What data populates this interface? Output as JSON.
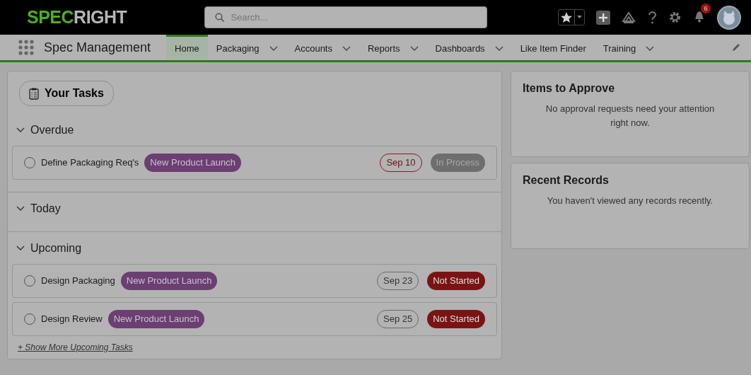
{
  "header": {
    "logo_accent": "SPEC",
    "logo_rest": "RIGHT",
    "search": {
      "placeholder": "Search..."
    },
    "notifications_count": "6"
  },
  "nav": {
    "app_name": "Spec Management",
    "tabs": [
      {
        "label": "Home",
        "selected": true,
        "has_menu": false
      },
      {
        "label": "Packaging",
        "selected": false,
        "has_menu": true
      },
      {
        "label": "Accounts",
        "selected": false,
        "has_menu": true
      },
      {
        "label": "Reports",
        "selected": false,
        "has_menu": true
      },
      {
        "label": "Dashboards",
        "selected": false,
        "has_menu": true
      },
      {
        "label": "Like Item Finder",
        "selected": false,
        "has_menu": false
      },
      {
        "label": "Training",
        "selected": false,
        "has_menu": true
      }
    ]
  },
  "tasks": {
    "title": "Your Tasks",
    "groups": [
      {
        "label": "Overdue",
        "expanded": true,
        "items": [
          {
            "name": "Define Packaging Req's",
            "checked": false,
            "tag": "New Product Launch",
            "date": "Sep 10",
            "overdue": true,
            "status": "In Process",
            "kind": "in-process"
          }
        ]
      },
      {
        "label": "Today",
        "expanded": true
      },
      {
        "label": "Upcoming",
        "expanded": true,
        "items": [
          {
            "name": "Design Packaging",
            "checked": false,
            "tag": "New Product Launch",
            "date": "Sep 23",
            "overdue": false,
            "status": "Not Started",
            "kind": "not-started"
          },
          {
            "name": "Design Review",
            "checked": false,
            "tag": "New Product Launch",
            "date": "Sep 25",
            "overdue": false,
            "status": "Not Started",
            "kind": "not-started"
          }
        ],
        "more_link": "+ Show More Upcoming Tasks"
      }
    ]
  },
  "side_cards": [
    {
      "title": "Items to Approve",
      "message": "No approval requests need your attention right now."
    },
    {
      "title": "Recent Records",
      "message": "You haven't viewed any records recently."
    }
  ]
}
